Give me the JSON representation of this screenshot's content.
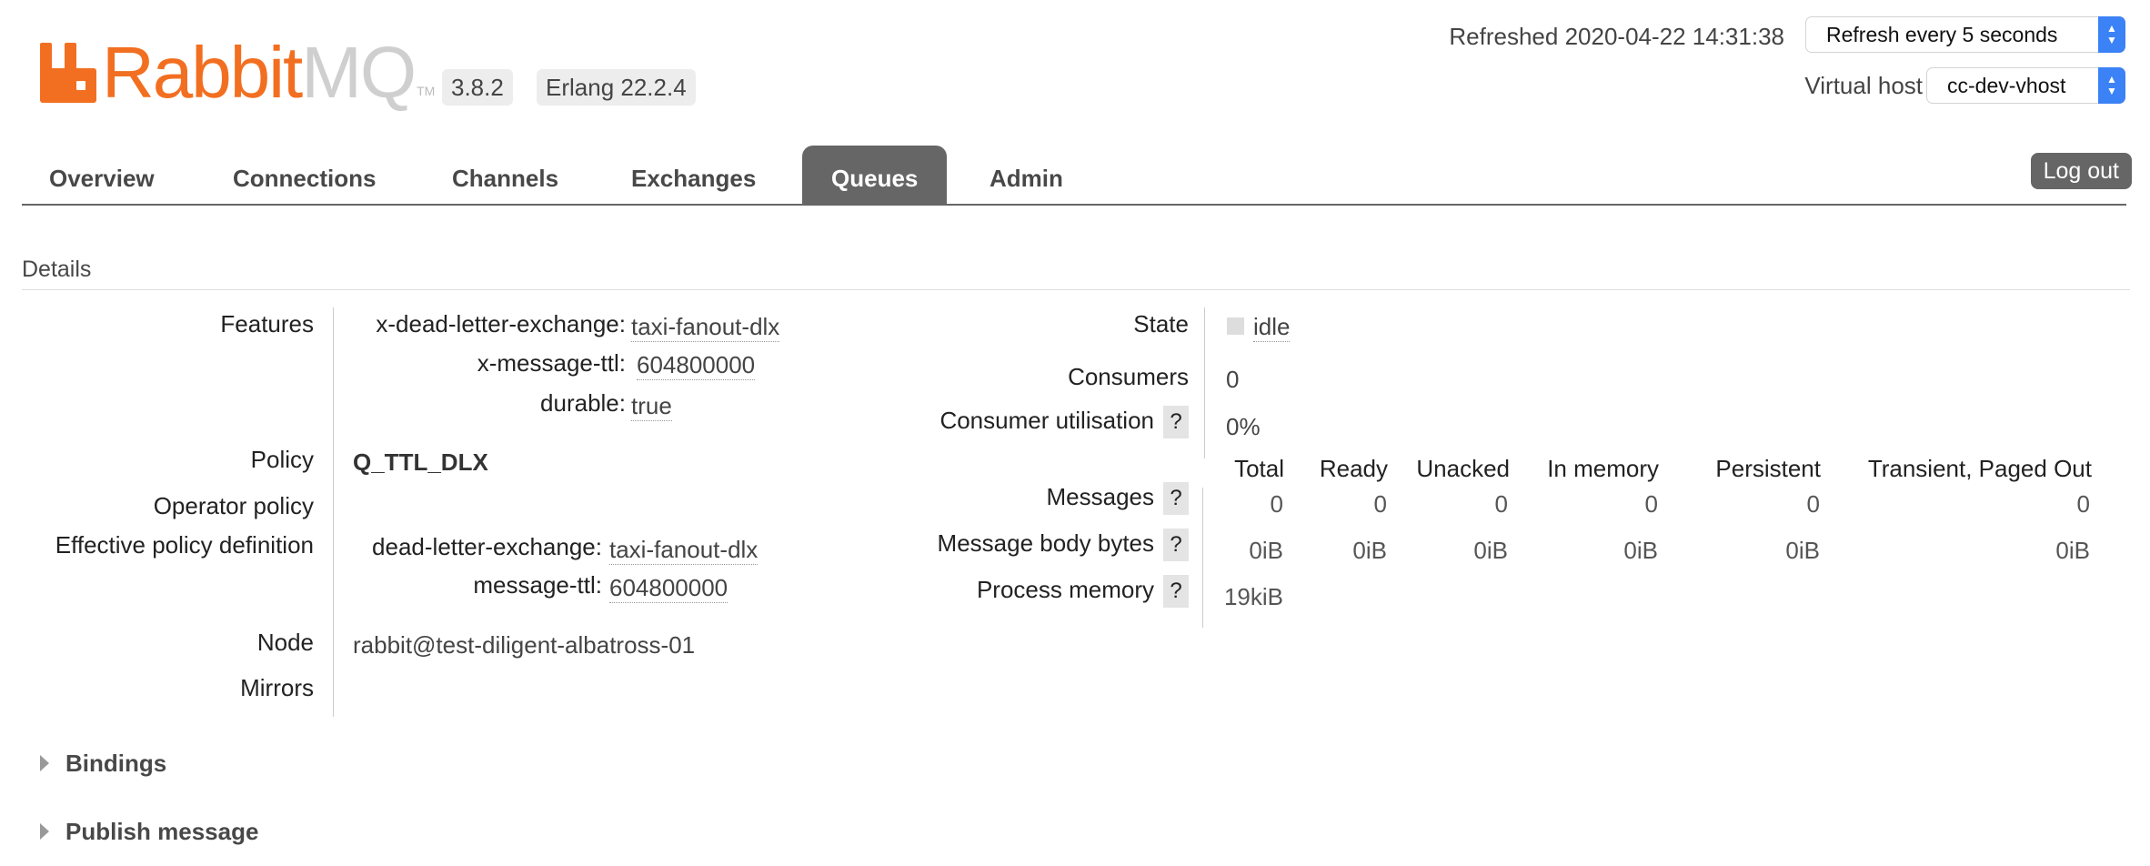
{
  "header": {
    "logo_rabbit": "Rabbit",
    "logo_mq": "MQ",
    "logo_tm": "TM",
    "version": "3.8.2",
    "erlang": "Erlang 22.2.4",
    "refreshed": "Refreshed 2020-04-22 14:31:38",
    "refresh_select": "Refresh every 5 seconds",
    "vhost_label": "Virtual host",
    "vhost_select": "cc-dev-vhost",
    "logout": "Log out"
  },
  "nav": {
    "tabs": [
      "Overview",
      "Connections",
      "Channels",
      "Exchanges",
      "Queues",
      "Admin"
    ],
    "active": "Queues"
  },
  "details": {
    "title": "Details",
    "features_label": "Features",
    "features": [
      {
        "key": "x-dead-letter-exchange:",
        "value": "taxi-fanout-dlx"
      },
      {
        "key": "x-message-ttl:",
        "value": "604800000"
      },
      {
        "key": "durable:",
        "value": "true"
      }
    ],
    "policy_label": "Policy",
    "policy": "Q_TTL_DLX",
    "operator_policy_label": "Operator policy",
    "effective_label": "Effective policy definition",
    "effective": [
      {
        "key": "dead-letter-exchange:",
        "value": "taxi-fanout-dlx"
      },
      {
        "key": "message-ttl:",
        "value": "604800000"
      }
    ],
    "node_label": "Node",
    "node": "rabbit@test-diligent-albatross-01",
    "mirrors_label": "Mirrors",
    "state_label": "State",
    "state": "idle",
    "consumers_label": "Consumers",
    "consumers": "0",
    "consumer_util_label": "Consumer utilisation",
    "consumer_util": "0%",
    "help": "?",
    "stats_headers": [
      "Total",
      "Ready",
      "Unacked",
      "In memory",
      "Persistent",
      "Transient, Paged Out"
    ],
    "messages_label": "Messages",
    "messages": [
      "0",
      "0",
      "0",
      "0",
      "0",
      "0"
    ],
    "body_bytes_label": "Message body bytes",
    "body_bytes": [
      "0iB",
      "0iB",
      "0iB",
      "0iB",
      "0iB",
      "0iB"
    ],
    "process_memory_label": "Process memory",
    "process_memory": "19kiB"
  },
  "sections": {
    "bindings": "Bindings",
    "publish": "Publish message"
  }
}
